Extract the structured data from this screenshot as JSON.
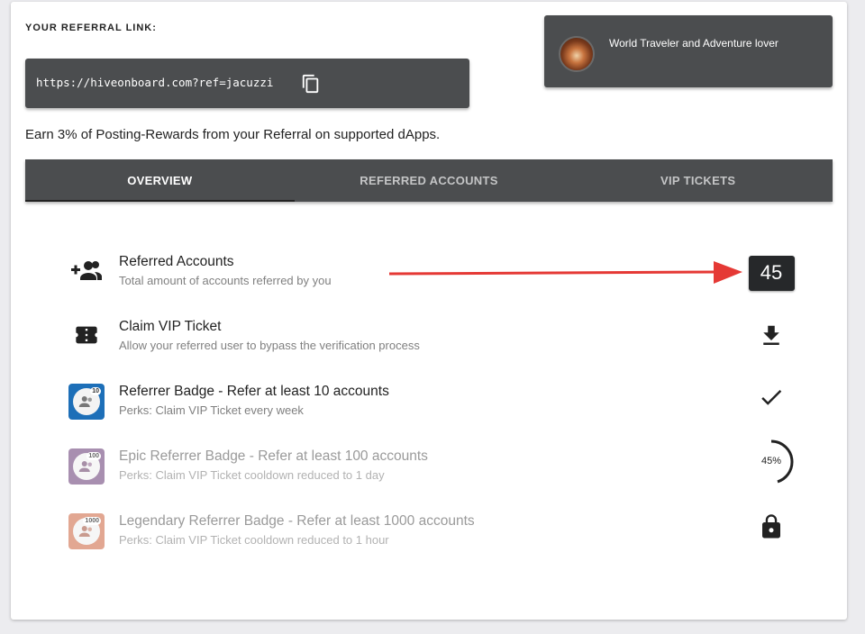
{
  "referral": {
    "heading": "YOUR REFERRAL LINK:",
    "link": "https://hiveonboard.com?ref=jacuzzi",
    "earn_text": "Earn 3% of Posting-Rewards from your Referral on supported dApps."
  },
  "profile": {
    "about": "World Traveler and Adventure lover"
  },
  "tabs": [
    {
      "label": "OVERVIEW",
      "active": true
    },
    {
      "label": "REFERRED ACCOUNTS",
      "active": false
    },
    {
      "label": "VIP TICKETS",
      "active": false
    }
  ],
  "overview": {
    "items": [
      {
        "title": "Referred Accounts",
        "subtitle": "Total amount of accounts referred by you",
        "icon": "group-add-icon",
        "value": "45"
      },
      {
        "title": "Claim VIP Ticket",
        "subtitle": "Allow your referred user to bypass the verification process",
        "icon": "ticket-icon",
        "action_icon": "download-icon"
      },
      {
        "title": "Referrer Badge - Refer at least 10 accounts",
        "subtitle": "Perks: Claim VIP Ticket every week",
        "icon": "badge-10-icon",
        "badge_number": "10",
        "badge_color": "#1d6fb8",
        "action_icon": "check-icon"
      },
      {
        "title": "Epic Referrer Badge - Refer at least 100 accounts",
        "subtitle": "Perks: Claim VIP Ticket cooldown reduced to 1 day",
        "icon": "badge-100-icon",
        "badge_number": "100",
        "badge_color": "#8c6a96",
        "progress_percent": 45,
        "progress_label": "45%"
      },
      {
        "title": "Legendary Referrer Badge - Refer at least 1000 accounts",
        "subtitle": "Perks: Claim VIP Ticket cooldown reduced to 1 hour",
        "icon": "badge-1000-icon",
        "badge_number": "1000",
        "badge_color": "#d98a6e",
        "action_icon": "lock-icon"
      }
    ]
  },
  "colors": {
    "panel_dark": "#4b4d4f",
    "arrow_red": "#e53935",
    "count_box": "#26282a"
  }
}
